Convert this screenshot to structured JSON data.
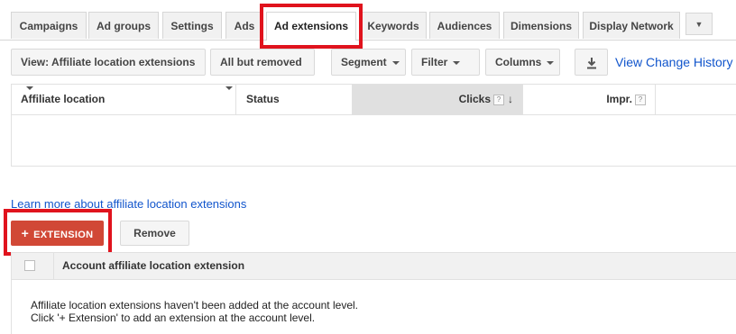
{
  "tabs": [
    {
      "label": "Campaigns",
      "active": false
    },
    {
      "label": "Ad groups",
      "active": false
    },
    {
      "label": "Settings",
      "active": false
    },
    {
      "label": "Ads",
      "active": false
    },
    {
      "label": "Ad extensions",
      "active": true
    },
    {
      "label": "Keywords",
      "active": false
    },
    {
      "label": "Audiences",
      "active": false
    },
    {
      "label": "Dimensions",
      "active": false
    },
    {
      "label": "Display Network",
      "active": false
    }
  ],
  "toolbar": {
    "view_label": "View: Affiliate location extensions",
    "status_filter_label": "All but removed",
    "segment_label": "Segment",
    "filter_label": "Filter",
    "columns_label": "Columns",
    "download_icon": "download-icon",
    "change_history_link": "View Change History"
  },
  "table": {
    "columns": [
      {
        "label": "Affiliate location",
        "help": false
      },
      {
        "label": "Status",
        "help": false
      },
      {
        "label": "Clicks",
        "help": true,
        "sorted": "descending"
      },
      {
        "label": "Impr.",
        "help": true
      }
    ],
    "rows": []
  },
  "learn_more_link": "Learn more about affiliate location extensions",
  "account_section": {
    "add_button_label": "EXTENSION",
    "add_button_icon": "plus-icon",
    "remove_button_label": "Remove",
    "column_header": "Account affiliate location extension",
    "empty_line1": "Affiliate location extensions haven't been added at the account level.",
    "empty_line2": "Click '+ Extension' to add an extension at the account level."
  },
  "colors": {
    "accent_red_button": "#d14836",
    "highlight_box": "#e0131d",
    "link": "#1155cc"
  }
}
